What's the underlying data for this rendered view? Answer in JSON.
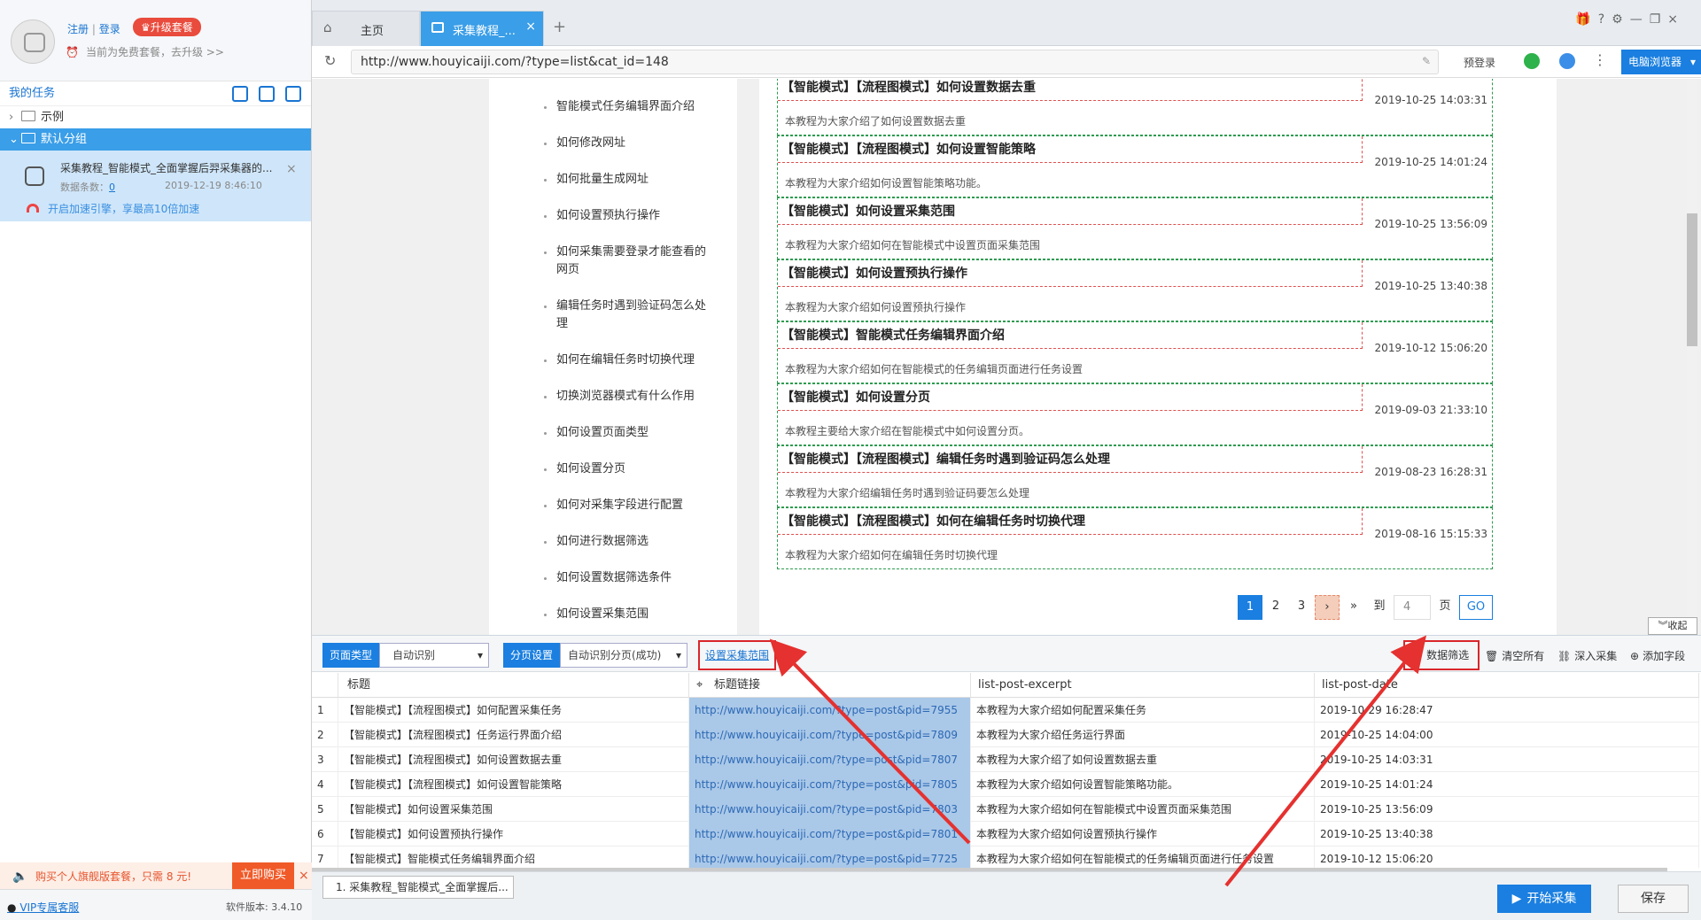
{
  "user": {
    "register": "注册",
    "separator": "|",
    "login": "登录",
    "upgrade": "升级套餐",
    "plan": "当前为免费套餐，去升级 >>"
  },
  "sidebar": {
    "my_tasks": "我的任务",
    "groups": [
      {
        "label": "示例"
      },
      {
        "label": "默认分组"
      }
    ],
    "task": {
      "title": "采集教程_智能模式_全面掌握后羿采集器的...",
      "count_label": "数据条数：",
      "count": "0",
      "time": "2019-12-19 8:46:10",
      "speed": "开启加速引擎，享最高10倍加速"
    },
    "promo": {
      "text": "购买个人旗舰版套餐，只需 8 元!",
      "buy": "立即购买"
    },
    "vip": "VIP专属客服",
    "version": "软件版本: 3.4.10"
  },
  "browser": {
    "tabs": [
      {
        "label": "主页"
      },
      {
        "label": "采集教程_..."
      }
    ],
    "url": "http://www.houyicaiji.com/?type=list&cat_id=148",
    "prelogin": "预登录",
    "mode": "电脑浏览器"
  },
  "page": {
    "left_links": [
      "智能模式任务编辑界面介绍",
      "如何修改网址",
      "如何批量生成网址",
      "如何设置预执行操作",
      "如何采集需要登录才能查看的网页",
      "编辑任务时遇到验证码怎么处理",
      "如何在编辑任务时切换代理",
      "切换浏览器模式有什么作用",
      "如何设置页面类型",
      "如何设置分页",
      "如何对采集字段进行配置",
      "如何进行数据筛选",
      "如何设置数据筛选条件",
      "如何设置采集范围"
    ],
    "articles": [
      {
        "title": "【智能模式】【流程图模式】如何设置数据去重",
        "date": "2019-10-25 14:03:31",
        "excerpt": "本教程为大家介绍了如何设置数据去重"
      },
      {
        "title": "【智能模式】【流程图模式】如何设置智能策略",
        "date": "2019-10-25 14:01:24",
        "excerpt": "本教程为大家介绍如何设置智能策略功能。"
      },
      {
        "title": "【智能模式】如何设置采集范围",
        "date": "2019-10-25 13:56:09",
        "excerpt": "本教程为大家介绍如何在智能模式中设置页面采集范围"
      },
      {
        "title": "【智能模式】如何设置预执行操作",
        "date": "2019-10-25 13:40:38",
        "excerpt": "本教程为大家介绍如何设置预执行操作"
      },
      {
        "title": "【智能模式】智能模式任务编辑界面介绍",
        "date": "2019-10-12 15:06:20",
        "excerpt": "本教程为大家介绍如何在智能模式的任务编辑页面进行任务设置"
      },
      {
        "title": "【智能模式】如何设置分页",
        "date": "2019-09-03 21:33:10",
        "excerpt": "本教程主要给大家介绍在智能模式中如何设置分页。"
      },
      {
        "title": "【智能模式】【流程图模式】编辑任务时遇到验证码怎么处理",
        "date": "2019-08-23 16:28:31",
        "excerpt": "本教程为大家介绍编辑任务时遇到验证码要怎么处理"
      },
      {
        "title": "【智能模式】【流程图模式】如何在编辑任务时切换代理",
        "date": "2019-08-16 15:15:33",
        "excerpt": "本教程为大家介绍如何在编辑任务时切换代理"
      }
    ],
    "pager": {
      "pages": [
        "1",
        "2",
        "3"
      ],
      "next": "›",
      "last": "»",
      "to": "到",
      "input": "4",
      "unit": "页",
      "go": "GO"
    },
    "collapse": "收起"
  },
  "config": {
    "page_type_label": "页面类型",
    "page_type_value": "自动识别",
    "paging_label": "分页设置",
    "paging_value": "自动识别分页(成功)",
    "set_range": "设置采集范围",
    "filter": "数据筛选",
    "clear": "清空所有",
    "deep": "深入采集",
    "add_field": "添加字段"
  },
  "table": {
    "headers": [
      "标题",
      "标题链接",
      "list-post-excerpt",
      "list-post-date"
    ],
    "rows": [
      [
        "1",
        "【智能模式】【流程图模式】如何配置采集任务",
        "http://www.houyicaiji.com/?type=post&pid=7955",
        "本教程为大家介绍如何配置采集任务",
        "2019-10-29 16:28:47"
      ],
      [
        "2",
        "【智能模式】【流程图模式】任务运行界面介绍",
        "http://www.houyicaiji.com/?type=post&pid=7809",
        "本教程为大家介绍任务运行界面",
        "2019-10-25 14:04:00"
      ],
      [
        "3",
        "【智能模式】【流程图模式】如何设置数据去重",
        "http://www.houyicaiji.com/?type=post&pid=7807",
        "本教程为大家介绍了如何设置数据去重",
        "2019-10-25 14:03:31"
      ],
      [
        "4",
        "【智能模式】【流程图模式】如何设置智能策略",
        "http://www.houyicaiji.com/?type=post&pid=7805",
        "本教程为大家介绍如何设置智能策略功能。",
        "2019-10-25 14:01:24"
      ],
      [
        "5",
        "【智能模式】如何设置采集范围",
        "http://www.houyicaiji.com/?type=post&pid=7803",
        "本教程为大家介绍如何在智能模式中设置页面采集范围",
        "2019-10-25 13:56:09"
      ],
      [
        "6",
        "【智能模式】如何设置预执行操作",
        "http://www.houyicaiji.com/?type=post&pid=7801",
        "本教程为大家介绍如何设置预执行操作",
        "2019-10-25 13:40:38"
      ],
      [
        "7",
        "【智能模式】智能模式任务编辑界面介绍",
        "http://www.houyicaiji.com/?type=post&pid=7725",
        "本教程为大家介绍如何在智能模式的任务编辑页面进行任务设置",
        "2019-10-12 15:06:20"
      ]
    ]
  },
  "bottom": {
    "task_tab": "1. 采集教程_智能模式_全面掌握后...",
    "start": "开始采集",
    "save": "保存"
  },
  "colors": {
    "accent": "#1a7fe0",
    "highlight_border": "#d9262b",
    "arrow": "#e5312f"
  }
}
